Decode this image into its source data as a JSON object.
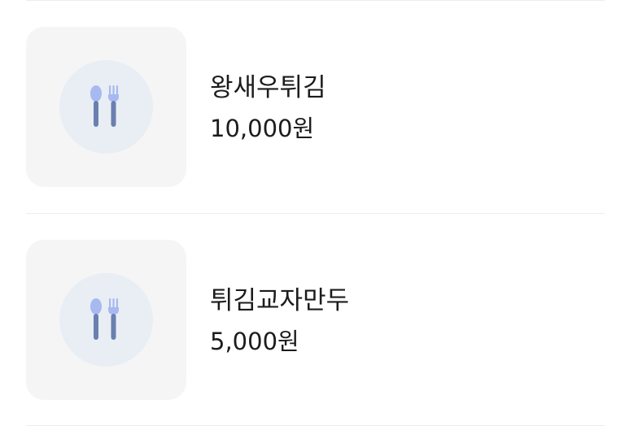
{
  "menu": {
    "items": [
      {
        "name": "왕새우튀김",
        "price": "10,000원",
        "image_icon": "utensils-icon"
      },
      {
        "name": "튀김교자만두",
        "price": "5,000원",
        "image_icon": "utensils-icon"
      }
    ]
  },
  "colors": {
    "thumb_bg": "#f5f5f6",
    "plate_bg": "#e8eef4",
    "utensil_light": "#a7b9f0",
    "utensil_dark": "#6b7fb0",
    "divider": "#ededed"
  }
}
